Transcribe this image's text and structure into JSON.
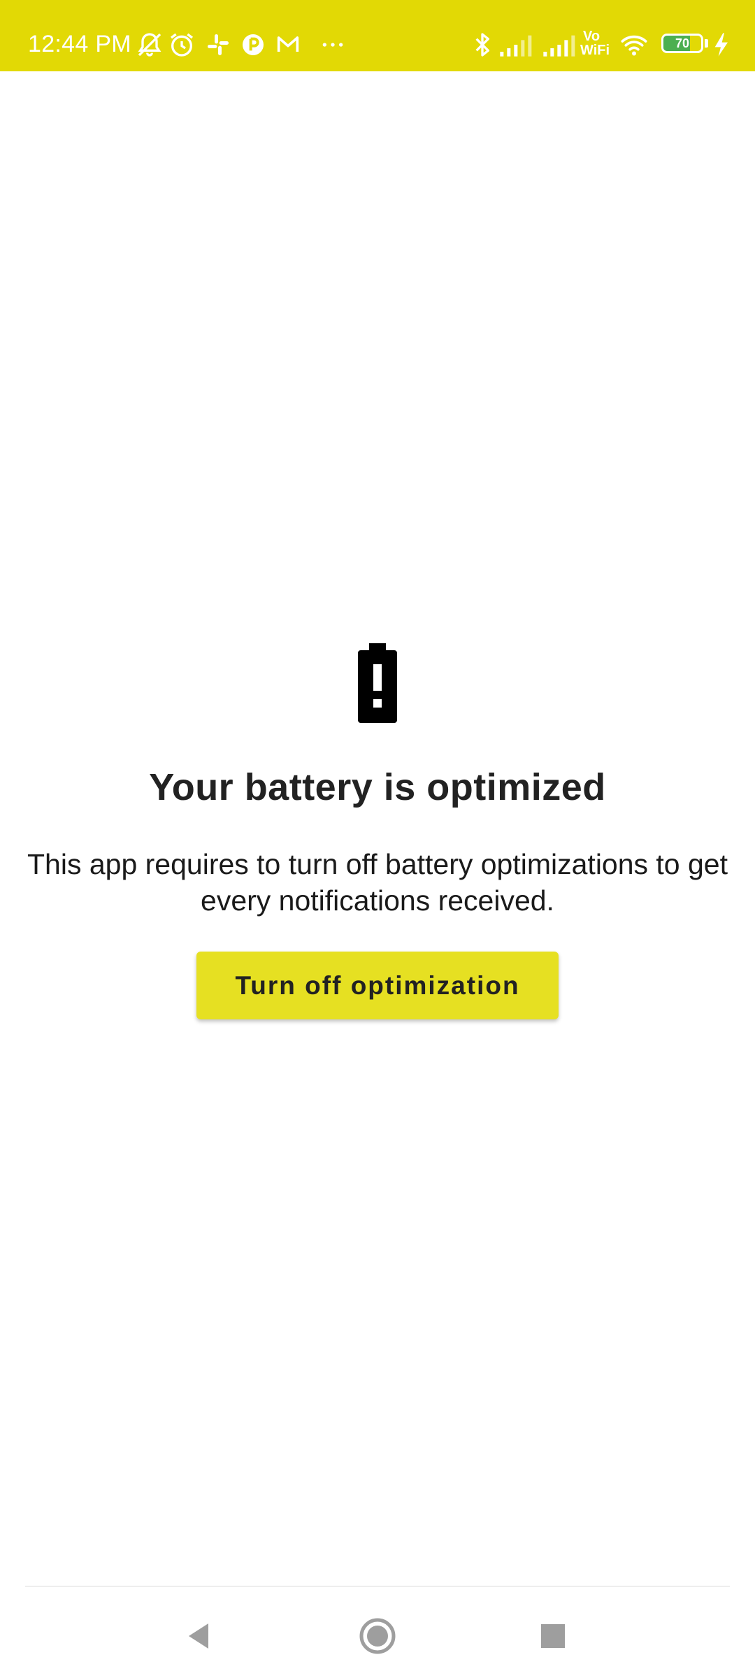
{
  "status_bar": {
    "time": "12:44 PM",
    "background_color": "#e2d905",
    "icons_left": [
      "notifications-off-icon",
      "alarm-icon",
      "slack-icon",
      "app-circle-icon",
      "gmail-icon",
      "more-dots-icon"
    ],
    "icons_right": [
      "bluetooth-icon",
      "signal-icon",
      "signal-icon",
      "vowifi-icon",
      "wifi-icon",
      "battery-icon",
      "charging-icon"
    ],
    "vowifi_top": "Vo",
    "vowifi_bottom": "WiFi",
    "battery_level": "70",
    "battery_fraction": 0.7
  },
  "main": {
    "icon": "battery-alert-icon",
    "title": "Your battery is optimized",
    "description": "This app requires to turn off battery optimizations to get every notifications received.",
    "button_label": "Turn off optimization",
    "button_color": "#e6e022"
  },
  "nav_bar": {
    "buttons": [
      "back-icon",
      "home-icon",
      "recents-icon"
    ]
  }
}
